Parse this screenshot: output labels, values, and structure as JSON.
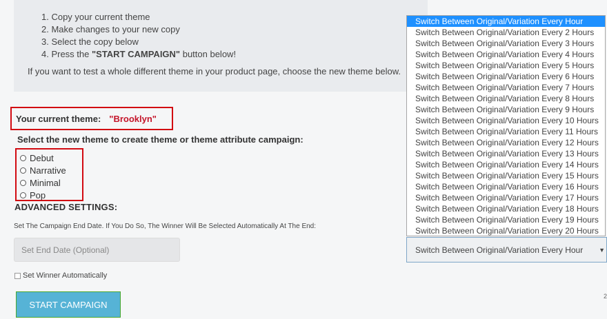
{
  "instructions": {
    "steps": [
      {
        "text": "1. Copy your current theme"
      },
      {
        "text": "2. Make changes to your new copy"
      },
      {
        "text": "3. Select the copy below"
      },
      {
        "prefix": "4. Press the ",
        "bold": "\"START CAMPAIGN\"",
        "suffix": " button below!"
      }
    ],
    "note": "If you want to test a whole different theme in your product page, choose the new theme below."
  },
  "current_theme": {
    "label": "Your current theme:",
    "value": "\"Brooklyn\""
  },
  "theme_select": {
    "title": "Select the new theme to create theme or theme attribute campaign:",
    "options": [
      "Debut",
      "Narrative",
      "Minimal",
      "Pop"
    ]
  },
  "advanced": {
    "title": "ADVANCED SETTINGS:",
    "end_date_note": "Set The Campaign End Date. If You Do So, The Winner Will Be Selected Automatically At The End:",
    "end_date_placeholder": "Set End Date (Optional)",
    "winner_label": "Set Winner Automatically"
  },
  "start_button": "START CAMPAIGN",
  "switch_dropdown": {
    "selected_value": "Switch Between Original/Variation Every Hour",
    "options": [
      "Switch Between Original/Variation Every Hour",
      "Switch Between Original/Variation Every 2 Hours",
      "Switch Between Original/Variation Every 3 Hours",
      "Switch Between Original/Variation Every 4 Hours",
      "Switch Between Original/Variation Every 5 Hours",
      "Switch Between Original/Variation Every 6 Hours",
      "Switch Between Original/Variation Every 7 Hours",
      "Switch Between Original/Variation Every 8 Hours",
      "Switch Between Original/Variation Every 9 Hours",
      "Switch Between Original/Variation Every 10 Hours",
      "Switch Between Original/Variation Every 11 Hours",
      "Switch Between Original/Variation Every 12 Hours",
      "Switch Between Original/Variation Every 13 Hours",
      "Switch Between Original/Variation Every 14 Hours",
      "Switch Between Original/Variation Every 15 Hours",
      "Switch Between Original/Variation Every 16 Hours",
      "Switch Between Original/Variation Every 17 Hours",
      "Switch Between Original/Variation Every 18 Hours",
      "Switch Between Original/Variation Every 19 Hours",
      "Switch Between Original/Variation Every 20 Hours"
    ],
    "highlighted_index": 0
  },
  "side_mark": "2",
  "colors": {
    "highlight_border": "#d20a11",
    "theme_name": "#c4152a",
    "button_bg": "#56b3d6",
    "button_border": "#4aa82d",
    "option_selected": "#1e90ff"
  }
}
